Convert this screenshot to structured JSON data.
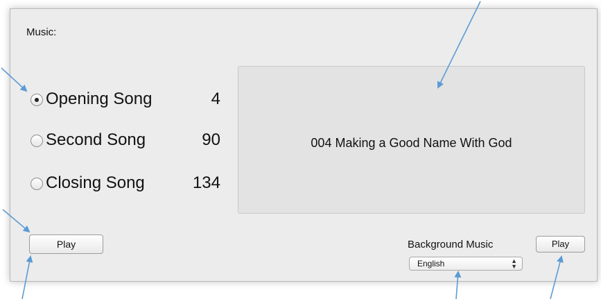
{
  "music": {
    "label": "Music:",
    "songs": [
      {
        "label": "Opening Song",
        "number": "4",
        "selected": true
      },
      {
        "label": "Second Song",
        "number": "90",
        "selected": false
      },
      {
        "label": "Closing Song",
        "number": "134",
        "selected": false
      }
    ],
    "display_text": "004 Making a Good Name With God",
    "play_label": "Play"
  },
  "background_music": {
    "label": "Background Music",
    "language_selected": "English",
    "play_label": "Play"
  },
  "colors": {
    "panel_bg": "#ececec",
    "display_bg": "#e3e3e3",
    "annotation_arrow": "#5b9bd5"
  },
  "icons": {
    "radio_selected": "radio-selected-icon",
    "radio_unselected": "radio-unselected-icon",
    "select_arrows": "updown-chevron-icon",
    "annotation": "arrow-icon"
  }
}
